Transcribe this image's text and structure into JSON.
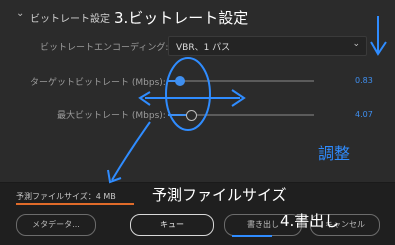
{
  "section": {
    "title": "ビットレート設定"
  },
  "encoding": {
    "label": "ビットレートエンコーディング:",
    "value": "VBR、1 パス"
  },
  "target": {
    "label": "ターゲットビットレート (Mbps):",
    "value": "0.83",
    "fraction": 0.08
  },
  "max": {
    "label": "最大ビットレート (Mbps):",
    "value": "4.07",
    "fraction": 0.16
  },
  "estimate": {
    "label": "予測ファイルサイズ：",
    "value": "4 MB"
  },
  "buttons": {
    "metadata": "メタデータ...",
    "queue": "キュー",
    "export": "書き出し",
    "cancel": "キャンセル"
  },
  "annotations": {
    "step3": "3.ビットレート設定",
    "adjust": "調整",
    "estimate_note": "予測ファイルサイズ",
    "step4": "4.書出し"
  },
  "colors": {
    "accent": "#3f8ff0",
    "underline": "#e06b2a",
    "handwriting": "#2f8cff"
  }
}
